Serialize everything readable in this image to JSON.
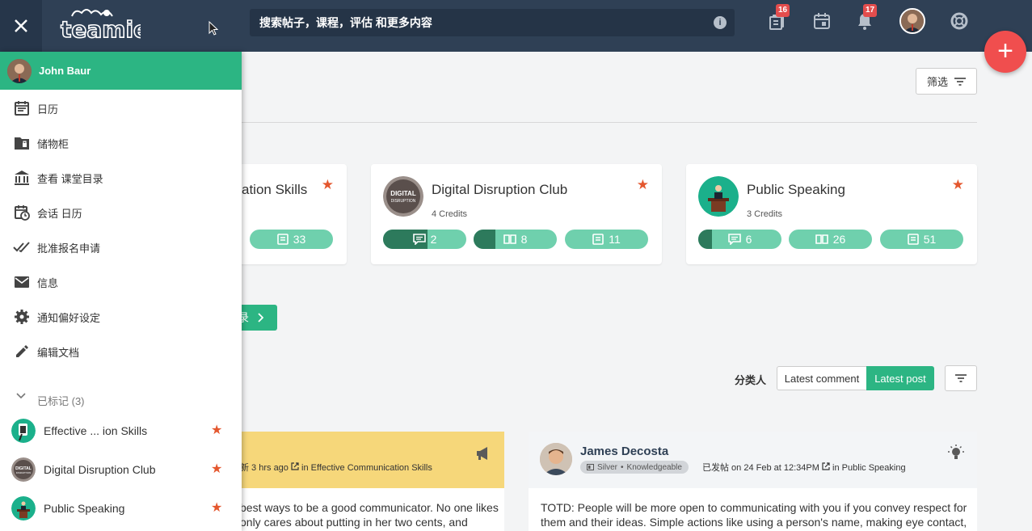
{
  "topbar": {
    "search_placeholder": "搜索帖子，课程，评估 和更多内容",
    "badges": {
      "lockers": "16",
      "notifications": "17"
    }
  },
  "fab_label": "+",
  "filter": {
    "label": "筛选"
  },
  "courses": [
    {
      "title": "Effective Communication Skills",
      "title_visible": "ation Skills",
      "credits": "",
      "stats": [
        "33"
      ]
    },
    {
      "title": "Digital Disruption Club",
      "credits": "4 Credits",
      "stats": [
        "2",
        "8",
        "11"
      ]
    },
    {
      "title": "Public Speaking",
      "credits": "3 Credits",
      "stats": [
        "6",
        "26",
        "51"
      ]
    }
  ],
  "catalog_button": {
    "label": "录"
  },
  "sort": {
    "label": "分类人",
    "options": [
      "Latest comment",
      "Latest post"
    ],
    "active": "Latest post"
  },
  "posts": [
    {
      "meta_prefix": "新 3 hrs ago",
      "meta_in": "in",
      "meta_course": "Effective Communication Skills",
      "body": "best ways to be a good communicator. No one likes only cares about putting in her two cents, and"
    },
    {
      "author": "James Decosta",
      "tag_level": "Silver",
      "tag_sep": "•",
      "tag_title": "Knowledgeable",
      "meta_prefix": "已发帖 on 24 Feb at 12:34PM",
      "meta_in": "in",
      "meta_course": "Public Speaking",
      "body": "TOTD: People will be more open to communicating with you if you convey respect for them and their ideas. Simple actions like using a person's name, making eye contact,"
    }
  ],
  "sidebar": {
    "user_name": "John Baur",
    "items": [
      {
        "label": "日历",
        "icon": "calendar-icon"
      },
      {
        "label": "储物柜",
        "icon": "locker-folder-icon"
      },
      {
        "label": "查看 课堂目录",
        "icon": "institution-icon"
      },
      {
        "label": "会话 日历",
        "icon": "session-calendar-icon"
      },
      {
        "label": "批准报名申请",
        "icon": "double-check-icon"
      },
      {
        "label": "信息",
        "icon": "mail-icon"
      },
      {
        "label": "通知偏好设定",
        "icon": "gear-icon"
      },
      {
        "label": "编辑文档",
        "icon": "pencil-icon"
      }
    ],
    "bookmarks_label": "已标记 (3)",
    "bookmarks": [
      {
        "name": "Effective ... ion Skills"
      },
      {
        "name": "Digital Disruption Club"
      },
      {
        "name": "Public Speaking"
      }
    ]
  },
  "colors": {
    "topbar": "#2f4055",
    "accent": "#2cb583",
    "star": "#e4572e",
    "fab": "#f04e4e"
  }
}
